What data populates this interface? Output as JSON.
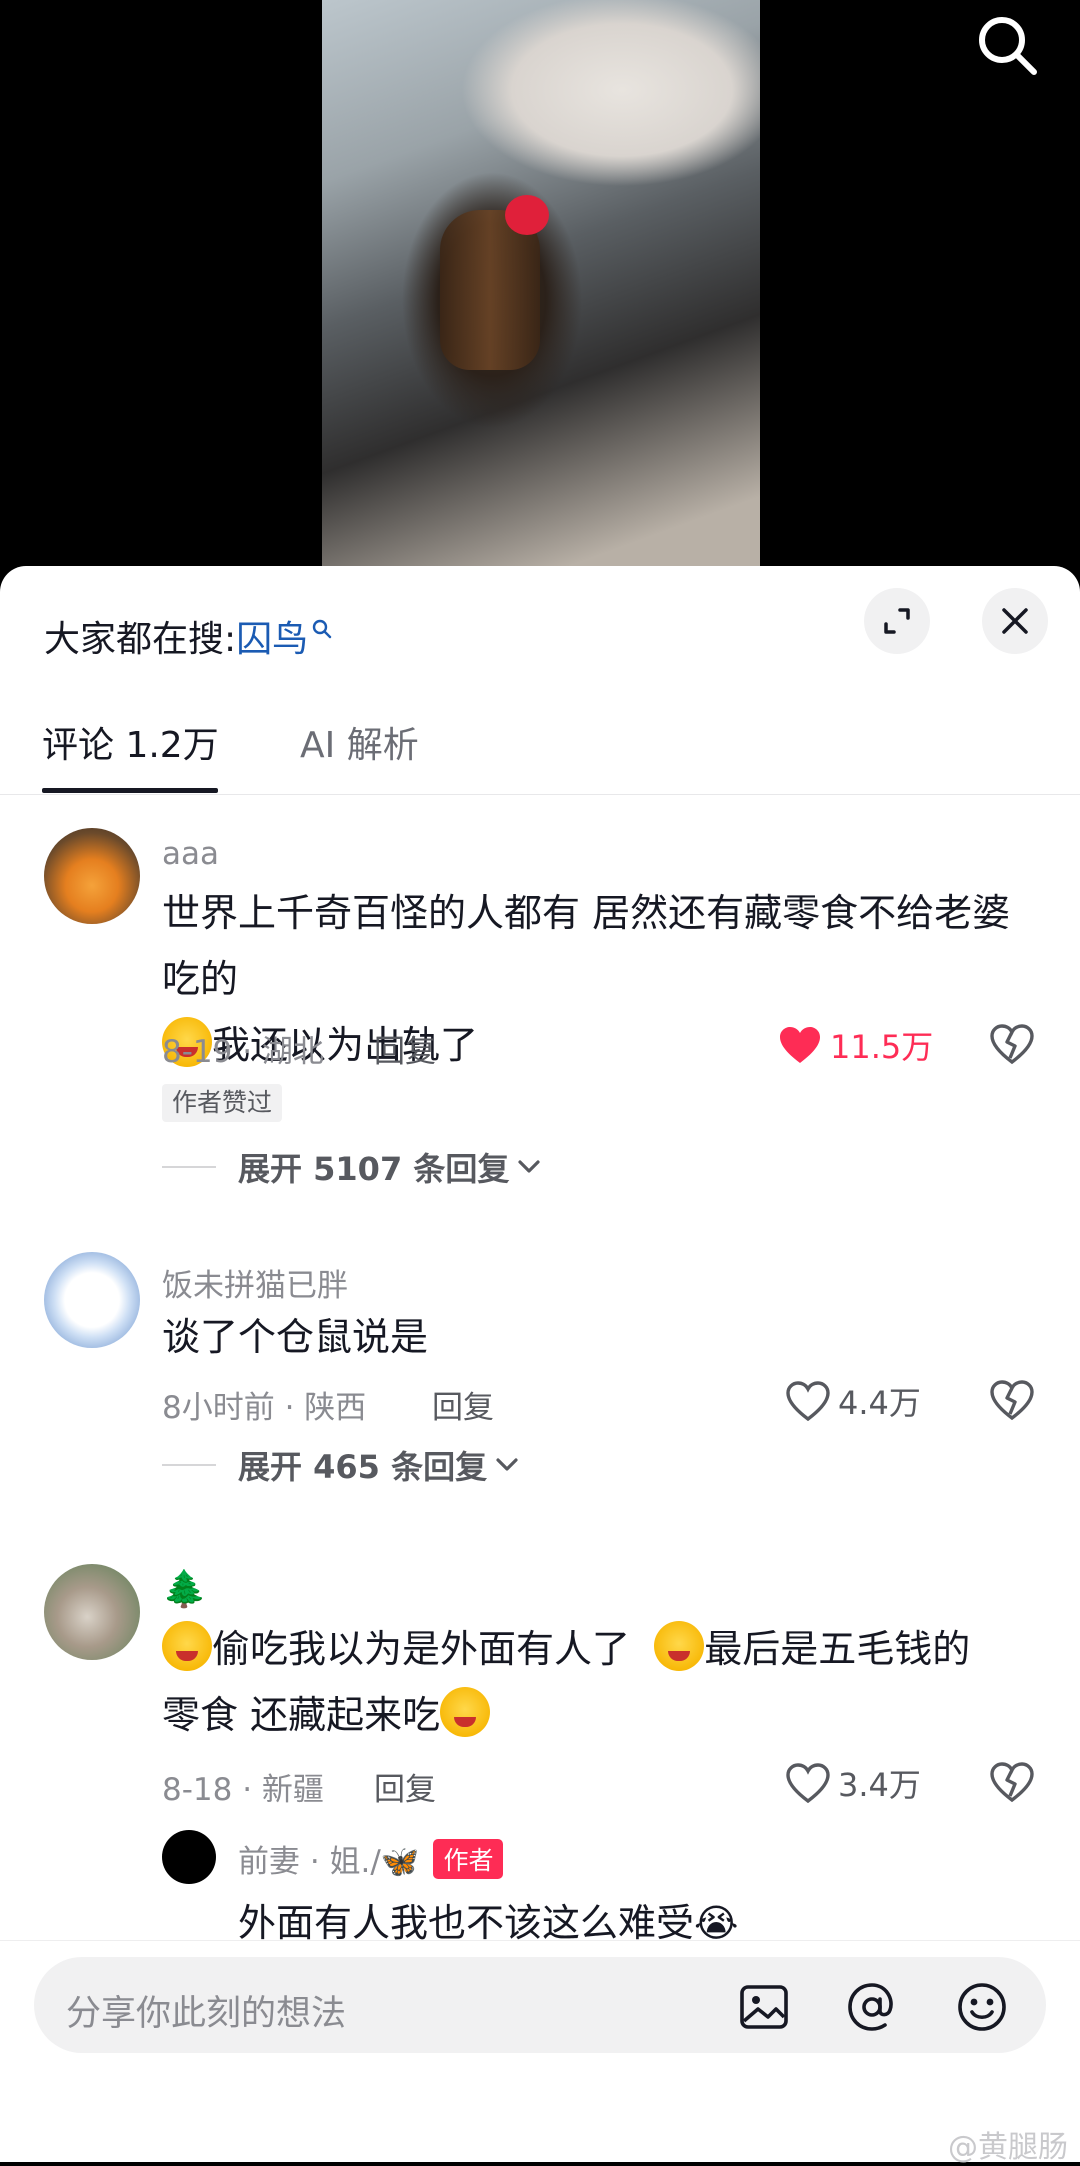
{
  "hot_search": {
    "label": "大家都在搜:",
    "term": "囚鸟"
  },
  "tabs": {
    "comments": "评论 1.2万",
    "ai": "AI 解析"
  },
  "comments": [
    {
      "username": "aaa",
      "text_part1": "世界上千奇百怪的人都有 居然还有藏零食不给老婆吃的",
      "text_part2": "我还以为出轨了",
      "meta": "8-19 · 湖北",
      "reply_label": "回复",
      "likes": "11.5万",
      "liked": true,
      "author_badge": "作者赞过",
      "expand_label": "展开 5107 条回复"
    },
    {
      "username": "饭未拼猫已胖",
      "text": "谈了个仓鼠说是",
      "meta": "8小时前 · 陕西",
      "reply_label": "回复",
      "likes": "4.4万",
      "expand_label": "展开 465 条回复"
    },
    {
      "username": "🌲",
      "text_part1": "偷吃我以为是外面有人了",
      "text_part2": "最后是五毛钱的",
      "text_part3": "零食 还藏起来吃",
      "meta": "8-18 · 新疆",
      "reply_label": "回复",
      "likes": "3.4万",
      "sub_reply": {
        "username": "前妻 · 姐./🦋",
        "tag": "作者",
        "text": "外面有人我也不该这么难受😭"
      }
    }
  ],
  "input": {
    "placeholder": "分享你此刻的想法"
  },
  "watermark": "@黄腿肠",
  "colors": {
    "accent": "#fe2c55",
    "link": "#1b5bb3"
  }
}
